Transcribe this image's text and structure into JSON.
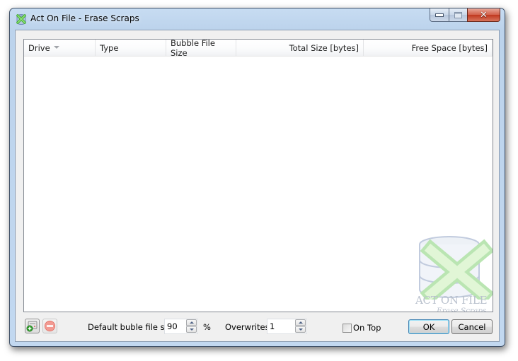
{
  "window": {
    "title": "Act On File - Erase Scraps",
    "icon": "act-on-file-icon",
    "caption_buttons": [
      "minimize",
      "maximize",
      "close"
    ]
  },
  "list": {
    "columns": [
      {
        "label": "Drive",
        "sorted": "descending"
      },
      {
        "label": "Type"
      },
      {
        "label": "Bubble File Size"
      },
      {
        "label": "Total Size [bytes]"
      },
      {
        "label": "Free Space [bytes]"
      }
    ],
    "rows": []
  },
  "watermark": {
    "line1": "ACT ON FILE",
    "line2": "Erase Scraps"
  },
  "bottom": {
    "add_drive_icon": "add-drive-icon",
    "remove_icon": "remove-icon",
    "bubble_label": "Default buble file size",
    "bubble_value": "90",
    "bubble_unit": "%",
    "overwrites_label": "Overwrites",
    "overwrites_value": "1",
    "on_top_label": "On Top",
    "on_top_checked": false,
    "ok_label": "OK",
    "cancel_label": "Cancel"
  }
}
